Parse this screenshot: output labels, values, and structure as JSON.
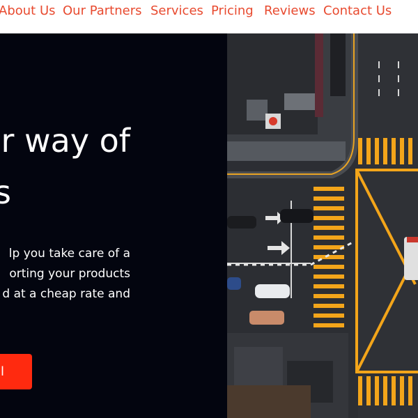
{
  "nav": {
    "items": [
      {
        "label": "About Us"
      },
      {
        "label": "Our Partners"
      },
      {
        "label": "Services"
      },
      {
        "label": "Pricing"
      },
      {
        "label": "Reviews"
      },
      {
        "label": "Contact Us"
      }
    ]
  },
  "hero": {
    "headline_line1": "er way of",
    "headline_line2": "s",
    "paragraph_lines": [
      "lp you take care of a",
      "orting your products",
      "d at a cheap rate and"
    ],
    "cta_label": "al"
  },
  "photo": {
    "description": ""
  },
  "colors": {
    "accent": "#e84a2f",
    "cta": "#ff2a0f",
    "hero_bg": "#03050f",
    "road_yellow": "#f3a51a"
  },
  "icons": {
    "photo": "aerial-city-intersection-image"
  }
}
